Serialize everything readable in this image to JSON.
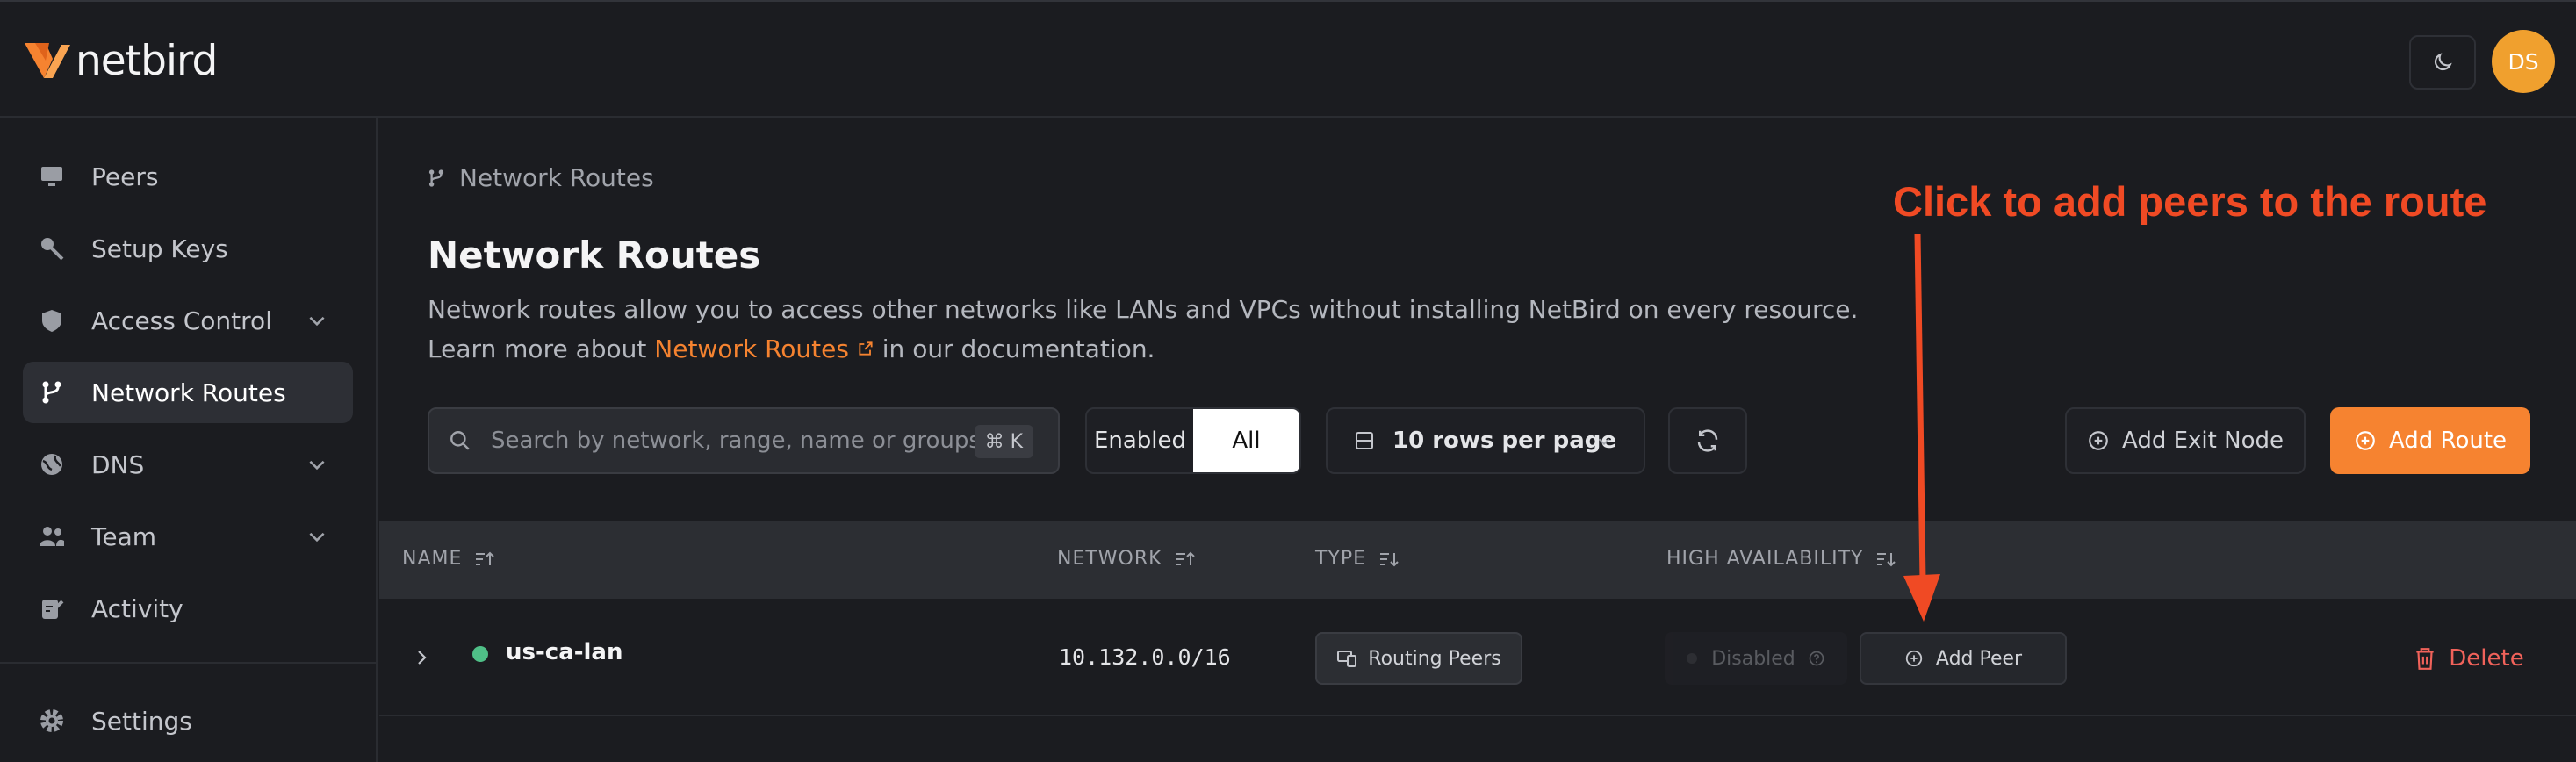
{
  "app": {
    "logo_text": "netbird",
    "user_initials": "DS"
  },
  "sidebar": {
    "items": [
      {
        "label": "Peers",
        "icon": "monitor-icon",
        "expandable": false,
        "active": false
      },
      {
        "label": "Setup Keys",
        "icon": "key-icon",
        "expandable": false,
        "active": false
      },
      {
        "label": "Access Control",
        "icon": "shield-icon",
        "expandable": true,
        "active": false
      },
      {
        "label": "Network Routes",
        "icon": "route-icon",
        "expandable": false,
        "active": true
      },
      {
        "label": "DNS",
        "icon": "globe-icon",
        "expandable": true,
        "active": false
      },
      {
        "label": "Team",
        "icon": "users-icon",
        "expandable": true,
        "active": false
      },
      {
        "label": "Activity",
        "icon": "activity-icon",
        "expandable": false,
        "active": false
      },
      {
        "label": "Settings",
        "icon": "gear-icon",
        "expandable": false,
        "active": false
      }
    ]
  },
  "page": {
    "breadcrumb": "Network Routes",
    "title": "Network Routes",
    "description_line1": "Network routes allow you to access other networks like LANs and VPCs without installing NetBird on every resource.",
    "description_prefix": "Learn more about",
    "description_link": "Network Routes",
    "description_suffix": "in our documentation."
  },
  "toolbar": {
    "search_placeholder": "Search by network, range, name or groups...",
    "search_shortcut": "⌘ K",
    "filter_enabled": "Enabled",
    "filter_all": "All",
    "rows_per_page": "10 rows per page",
    "add_exit_node": "Add Exit Node",
    "add_route": "Add Route"
  },
  "table": {
    "columns": [
      "NAME",
      "NETWORK",
      "TYPE",
      "HIGH AVAILABILITY"
    ],
    "rows": [
      {
        "name": "us-ca-lan",
        "network": "10.132.0.0/16",
        "type": "Routing Peers",
        "high_availability": "Disabled",
        "add_peer": "Add Peer",
        "delete": "Delete"
      }
    ]
  },
  "annotation": {
    "text": "Click to add peers to the route",
    "color": "#f04a24"
  },
  "colors": {
    "accent": "#f68330",
    "status_online": "#4fbf87",
    "danger": "#f0625a"
  }
}
